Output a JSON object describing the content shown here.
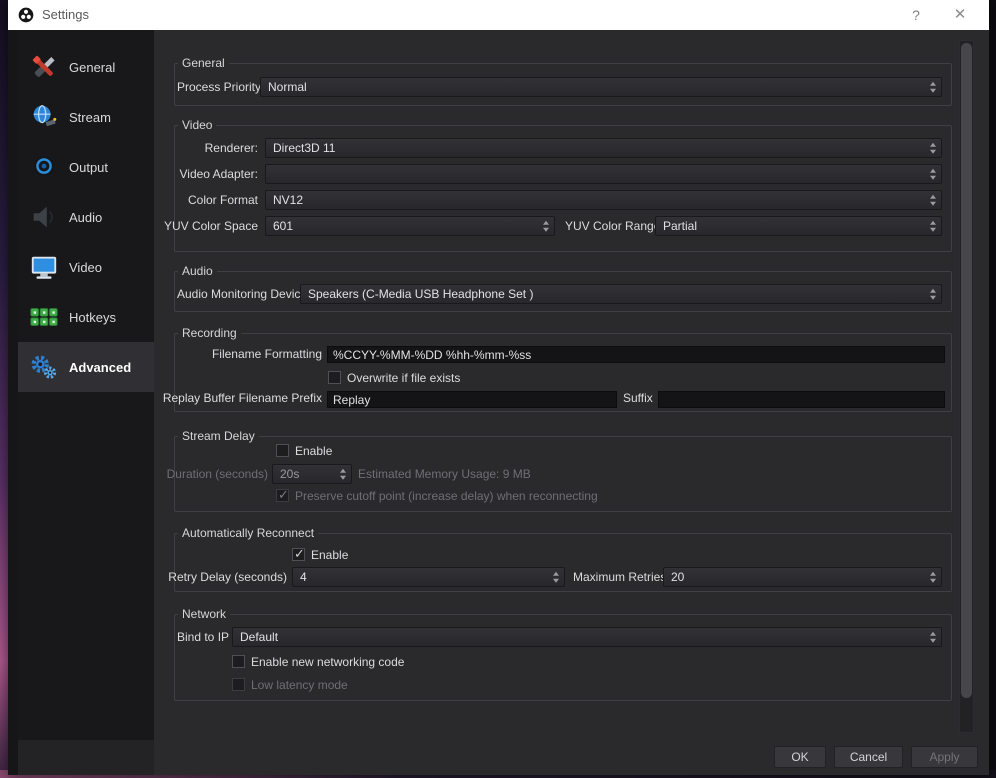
{
  "window": {
    "title": "Settings",
    "help_label": "?",
    "close_label": "✕"
  },
  "colors": {
    "accent_blue": "#2e7fd0",
    "hotkeys_green": "#3fae49",
    "tool_red": "#c0392b",
    "titlebar_bg": "#ffffff"
  },
  "sidebar": {
    "items": [
      {
        "label": "General",
        "icon": "tools-icon"
      },
      {
        "label": "Stream",
        "icon": "globe-satellite-icon"
      },
      {
        "label": "Output",
        "icon": "disc-icon"
      },
      {
        "label": "Audio",
        "icon": "speaker-icon"
      },
      {
        "label": "Video",
        "icon": "monitor-icon"
      },
      {
        "label": "Hotkeys",
        "icon": "keyboard-keys-icon"
      },
      {
        "label": "Advanced",
        "icon": "gears-icon",
        "selected": true
      }
    ]
  },
  "groups": {
    "general": {
      "title": "General",
      "process_priority_label": "Process Priority",
      "process_priority_value": "Normal"
    },
    "video": {
      "title": "Video",
      "renderer_label": "Renderer:",
      "renderer_value": "Direct3D 11",
      "video_adapter_label": "Video Adapter:",
      "video_adapter_value": "",
      "color_format_label": "Color Format",
      "color_format_value": "NV12",
      "yuv_space_label": "YUV Color Space",
      "yuv_space_value": "601",
      "yuv_range_label": "YUV Color Range",
      "yuv_range_value": "Partial"
    },
    "audio": {
      "title": "Audio",
      "monitoring_label": "Audio Monitoring Device",
      "monitoring_value": "Speakers (C-Media USB Headphone Set )"
    },
    "recording": {
      "title": "Recording",
      "filename_label": "Filename Formatting",
      "filename_value": "%CCYY-%MM-%DD %hh-%mm-%ss",
      "overwrite_label": "Overwrite if file exists",
      "overwrite_checked": false,
      "replay_prefix_label": "Replay Buffer Filename Prefix",
      "replay_prefix_value": "Replay",
      "suffix_label": "Suffix",
      "suffix_value": ""
    },
    "stream_delay": {
      "title": "Stream Delay",
      "enable_label": "Enable",
      "enable_checked": false,
      "duration_label": "Duration (seconds)",
      "duration_value": "20s",
      "memory_text": "Estimated Memory Usage: 9 MB",
      "preserve_label": "Preserve cutoff point (increase delay) when reconnecting",
      "preserve_checked": true
    },
    "reconnect": {
      "title": "Automatically Reconnect",
      "enable_label": "Enable",
      "enable_checked": true,
      "retry_label": "Retry Delay (seconds)",
      "retry_value": "4",
      "max_label": "Maximum Retries",
      "max_value": "20"
    },
    "network": {
      "title": "Network",
      "bind_label": "Bind to IP",
      "bind_value": "Default",
      "new_networking_label": "Enable new networking code",
      "new_networking_checked": false,
      "low_latency_label": "Low latency mode",
      "low_latency_checked": false
    }
  },
  "footer": {
    "ok_label": "OK",
    "cancel_label": "Cancel",
    "apply_label": "Apply"
  }
}
